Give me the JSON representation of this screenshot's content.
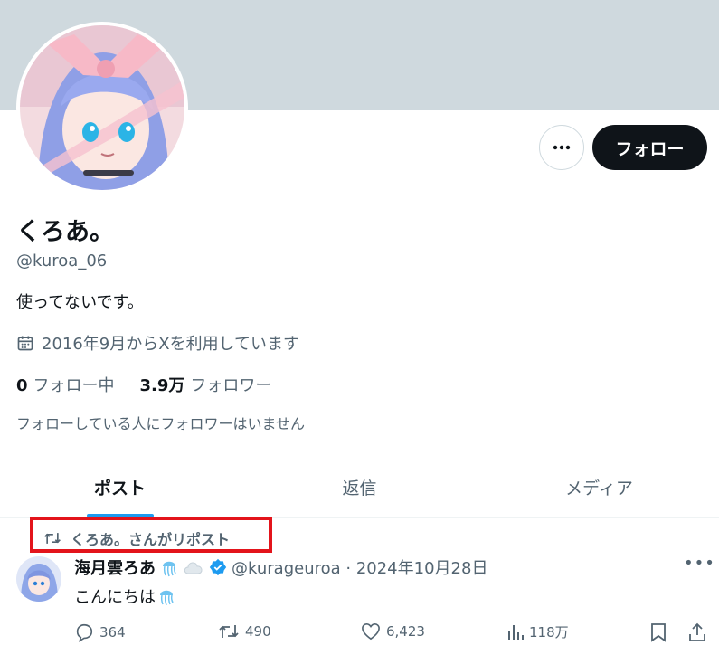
{
  "profile": {
    "display_name": "くろあ。",
    "handle": "@kuroa_06",
    "bio": "使ってないです。",
    "joined": "2016年9月からXを利用しています",
    "following_count": "0",
    "following_label": "フォロー中",
    "followers_count": "3.9万",
    "followers_label": "フォロワー",
    "no_followers_text": "フォローしている人にフォロワーはいません"
  },
  "buttons": {
    "follow": "フォロー",
    "more_icon": "more-icon"
  },
  "tabs": [
    {
      "label": "ポスト",
      "active": true
    },
    {
      "label": "返信",
      "active": false
    },
    {
      "label": "メディア",
      "active": false
    }
  ],
  "post": {
    "repost_text": "くろあ。さんがリポスト",
    "author": "海月雲ろあ",
    "handle_date": "@kurageuroa · 2024年10月28日",
    "text": "こんにちは",
    "replies": "364",
    "reposts": "490",
    "likes": "6,423",
    "views": "118万"
  },
  "colors": {
    "accent": "#1d9bf0",
    "highlight_box": "#e3141b",
    "banner": "#cfd9de"
  }
}
